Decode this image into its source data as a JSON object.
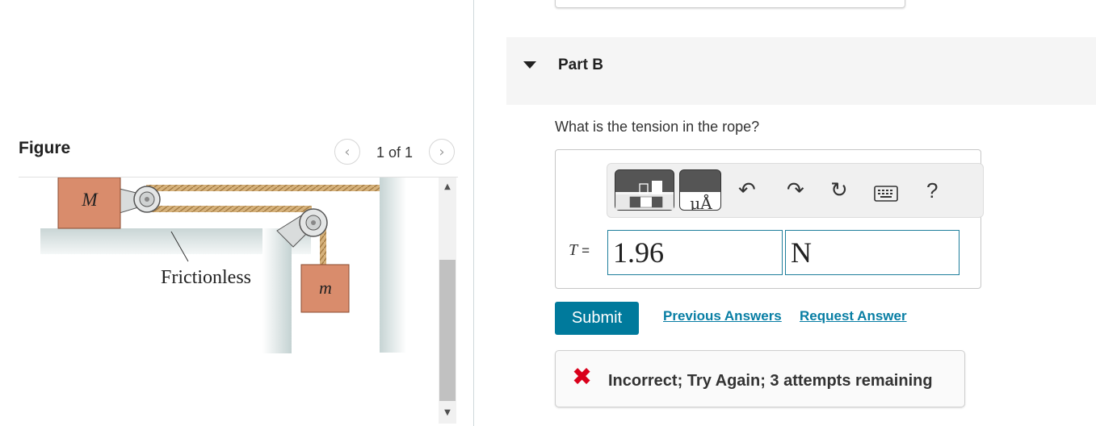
{
  "figure": {
    "title": "Figure",
    "pager": "1 of 1",
    "prev_icon": "chevron-left-icon",
    "next_icon": "chevron-right-icon",
    "labels": {
      "big_block": "M",
      "small_block": "m",
      "surface": "Frictionless"
    }
  },
  "part": {
    "title": "Part B"
  },
  "question": "What is the tension in the rope?",
  "toolbar": {
    "icons": [
      "templates-icon",
      "units-icon",
      "undo-icon",
      "redo-icon",
      "reset-icon",
      "keyboard-icon",
      "help-icon"
    ],
    "units_label": "μÅ",
    "help_label": "?"
  },
  "answer": {
    "label_var": "T",
    "label_eq": "=",
    "value": "1.96",
    "unit": "N"
  },
  "actions": {
    "submit": "Submit",
    "previous_answers": "Previous Answers",
    "request_answer": "Request Answer"
  },
  "feedback": {
    "message": "Incorrect; Try Again; 3 attempts remaining",
    "icon": "x-icon"
  },
  "colors": {
    "accent": "#007a9c",
    "link": "#087ea4",
    "error": "#d9001b",
    "block": "#d98c6c"
  }
}
